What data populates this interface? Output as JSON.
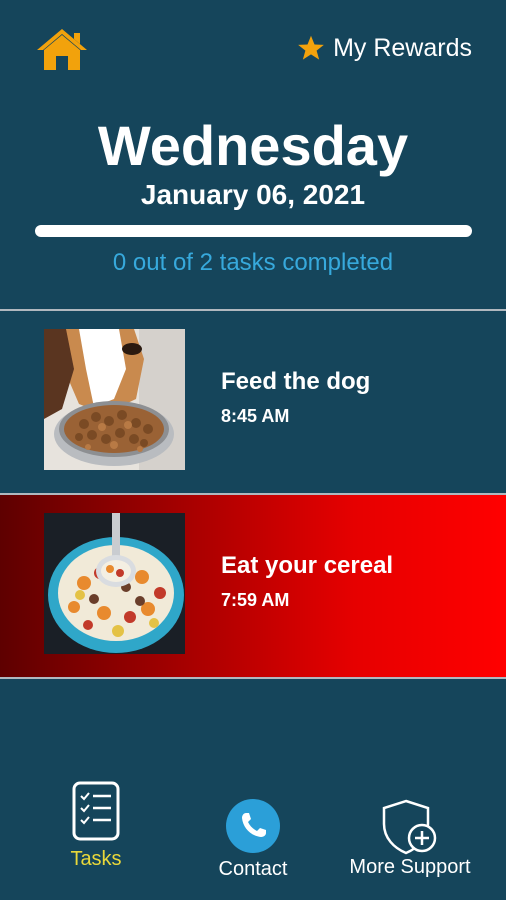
{
  "header": {
    "home_icon": "home-icon",
    "rewards_label": "My Rewards",
    "rewards_icon": "star-icon"
  },
  "summary": {
    "day": "Wednesday",
    "date": "January 06, 2021",
    "progress_fraction": 0,
    "progress_text": "0 out of 2 tasks completed"
  },
  "tasks": [
    {
      "title": "Feed the dog",
      "time": "8:45 AM",
      "image": "dog-eating-kibble",
      "highlight": false
    },
    {
      "title": "Eat your cereal",
      "time": "7:59 AM",
      "image": "cereal-bowl",
      "highlight": true
    }
  ],
  "bottom_nav": {
    "tasks_label": "Tasks",
    "contact_label": "Contact",
    "support_label": "More Support",
    "active": "Tasks"
  },
  "colors": {
    "background": "#15455b",
    "accent_orange": "#f2a20c",
    "progress_text": "#37a9dc",
    "active_nav": "#e9d83a",
    "alert_red": "#ff0000"
  }
}
